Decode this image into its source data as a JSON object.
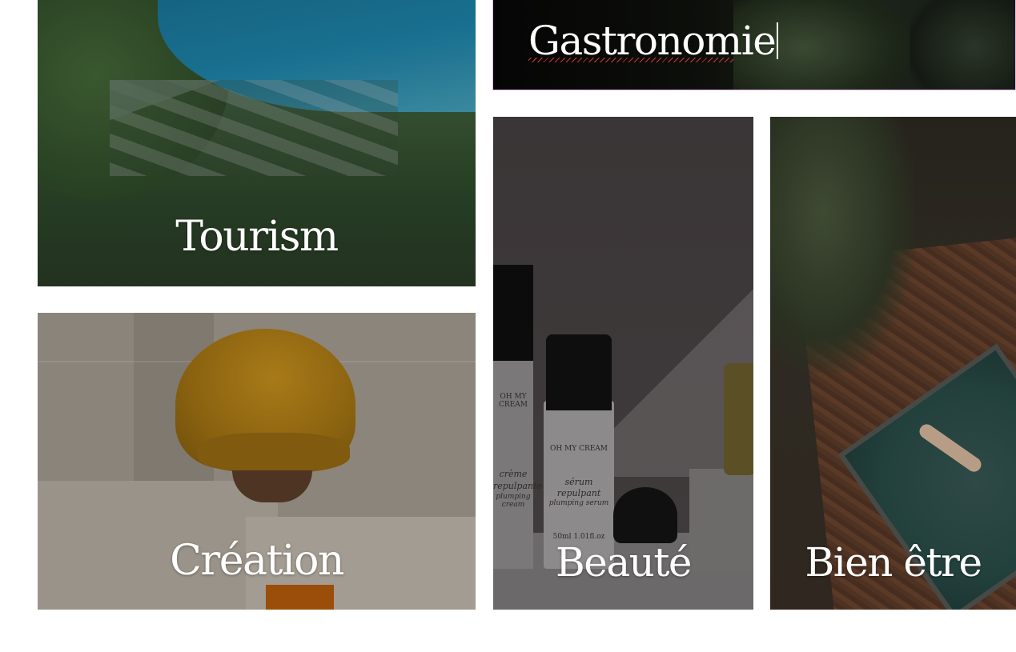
{
  "tiles": {
    "tourism": {
      "label": "Tourism"
    },
    "gastronomie": {
      "label": "Gastronomie"
    },
    "creation": {
      "label": "Création"
    },
    "beaute": {
      "label": "Beauté",
      "product_left": [
        "OH MY CREAM",
        "crème",
        "repulpante",
        "plumping cream"
      ],
      "product_center": [
        "OH MY CREAM",
        "sérum",
        "repulpant",
        "plumping serum",
        "50ml 1.01fl.oz"
      ]
    },
    "bienetre": {
      "label": "Bien être"
    }
  },
  "colors": {
    "label_text": "#ffffff",
    "editing_outline": "#e8b7f0",
    "spellcheck_underline": "#e23a3a"
  }
}
